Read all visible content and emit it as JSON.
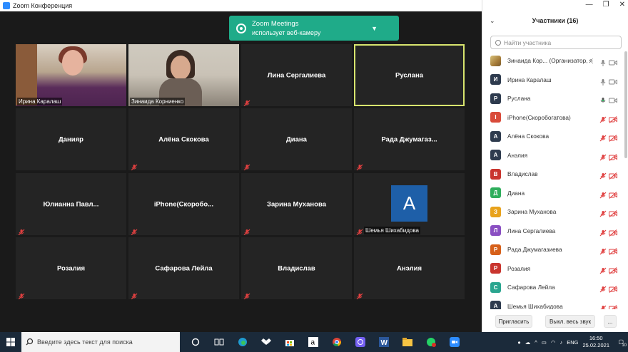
{
  "window": {
    "title": "Zoom Конференция"
  },
  "toast": {
    "line1": "Zoom Meetings",
    "line2": "использует веб-камеру"
  },
  "tiles": [
    {
      "name": "Ирина Каралаш",
      "type": "video"
    },
    {
      "name": "Зинаида Корниенко",
      "type": "video"
    },
    {
      "name": "Лина Сергалиева",
      "muted": true
    },
    {
      "name": "Руслана",
      "active": true
    },
    {
      "name": "Данияр"
    },
    {
      "name": "Алёна Скокова",
      "muted": true
    },
    {
      "name": "Диана",
      "muted": true
    },
    {
      "name": "Рада Джумагаз...",
      "muted": true
    },
    {
      "name": "Юлианна Павл...",
      "muted": true
    },
    {
      "name": "iPhone(Скоробо...",
      "muted": true
    },
    {
      "name": "Зарина Муханова",
      "muted": true
    },
    {
      "name": "Шемья Шихабидова",
      "muted": true,
      "avatar": "A"
    },
    {
      "name": "Розалия",
      "muted": true
    },
    {
      "name": "Сафарова Лейла",
      "muted": true
    },
    {
      "name": "Владислав",
      "muted": true
    },
    {
      "name": "Анэлия",
      "muted": true
    }
  ],
  "panel": {
    "title": "Участники (16)",
    "search_placeholder": "Найти участника",
    "participants": [
      {
        "initial": "",
        "name": "Зинаида Кор...  (Организатор, я)",
        "color": "#c8a24a",
        "mic": "on",
        "cam": "on",
        "photo": true
      },
      {
        "initial": "И",
        "name": "Ирина Каралаш",
        "color": "#2e3b4e",
        "mic": "on",
        "cam": "on"
      },
      {
        "initial": "Р",
        "name": "Руслана",
        "color": "#2e3b4e",
        "mic": "speaking",
        "cam": "on"
      },
      {
        "initial": "I",
        "name": "iPhone(Скоробогатова)",
        "color": "#d94b3a",
        "mic": "off",
        "cam": "off"
      },
      {
        "initial": "А",
        "name": "Алёна Скокова",
        "color": "#2e3b4e",
        "mic": "off",
        "cam": "off"
      },
      {
        "initial": "А",
        "name": "Анэлия",
        "color": "#2e3b4e",
        "mic": "off",
        "cam": "off"
      },
      {
        "initial": "В",
        "name": "Владислав",
        "color": "#c9352e",
        "mic": "off",
        "cam": "off"
      },
      {
        "initial": "Д",
        "name": "Диана",
        "color": "#2fae5c",
        "mic": "off",
        "cam": "off"
      },
      {
        "initial": "З",
        "name": "Зарина Муханова",
        "color": "#e8a21c",
        "mic": "off",
        "cam": "off"
      },
      {
        "initial": "Л",
        "name": "Лина Сергалиева",
        "color": "#8a4fc2",
        "mic": "off",
        "cam": "off"
      },
      {
        "initial": "Р",
        "name": "Рада Джумагазиева",
        "color": "#d6601a",
        "mic": "off",
        "cam": "off"
      },
      {
        "initial": "Р",
        "name": "Розалия",
        "color": "#c9352e",
        "mic": "off",
        "cam": "off"
      },
      {
        "initial": "С",
        "name": "Сафарова Лейла",
        "color": "#2aa58f",
        "mic": "off",
        "cam": "off"
      },
      {
        "initial": "А",
        "name": "Шемья Шихабидова",
        "color": "#2e3b4e",
        "mic": "off",
        "cam": "off"
      }
    ],
    "invite_label": "Пригласить",
    "mute_all_label": "Выкл. весь звук",
    "more_label": "..."
  },
  "taskbar": {
    "search_placeholder": "Введите здесь текст для поиска",
    "lang": "ENG",
    "time": "16:50",
    "date": "25.02.2021",
    "notif_count": "10"
  }
}
